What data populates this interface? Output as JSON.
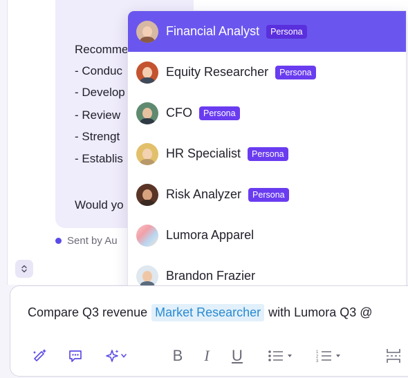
{
  "message": {
    "lines": [
      "Recomme",
      "- Conduc",
      "- Develop",
      "- Review",
      "- Strengt",
      "- Establis",
      "Would yo"
    ],
    "sent_by": "Sent by Au"
  },
  "dropdown": {
    "items": [
      {
        "label": "Financial Analyst",
        "badge": "Persona",
        "icon": "avatar-woman-icon"
      },
      {
        "label": "Equity Researcher",
        "badge": "Persona",
        "icon": "avatar-woman-red-hair-icon"
      },
      {
        "label": "CFO",
        "badge": "Persona",
        "icon": "avatar-man-glasses-icon"
      },
      {
        "label": "HR Specialist",
        "badge": "Persona",
        "icon": "avatar-woman-blonde-icon"
      },
      {
        "label": "Risk Analyzer",
        "badge": "Persona",
        "icon": "avatar-woman-dark-hair-icon"
      },
      {
        "label": "Lumora Apparel",
        "badge": "",
        "icon": "brand-logo-icon"
      },
      {
        "label": "Brandon Frazier",
        "badge": "",
        "icon": "avatar-cartoon-man-icon"
      }
    ],
    "selected_index": 0
  },
  "composer": {
    "text_before": "Compare Q3 revenue",
    "mention": "Market Researcher",
    "text_after": "with Lumora Q3 @"
  },
  "toolbar": {
    "bold": "B",
    "italic": "I",
    "underline": "U",
    "icons": [
      "magic-pen-icon",
      "comment-icon",
      "sparkles-icon",
      "chevron-down-icon",
      "bold-icon",
      "italic-icon",
      "underline-icon",
      "bullet-list-icon",
      "chevron-down-icon",
      "numbered-list-icon",
      "chevron-down-icon",
      "page-break-icon"
    ]
  },
  "colors": {
    "accent": "#6a56ee",
    "badge": "#6a3cf0",
    "mention_bg": "#e1f0fb",
    "mention_text": "#2a8ad0"
  }
}
